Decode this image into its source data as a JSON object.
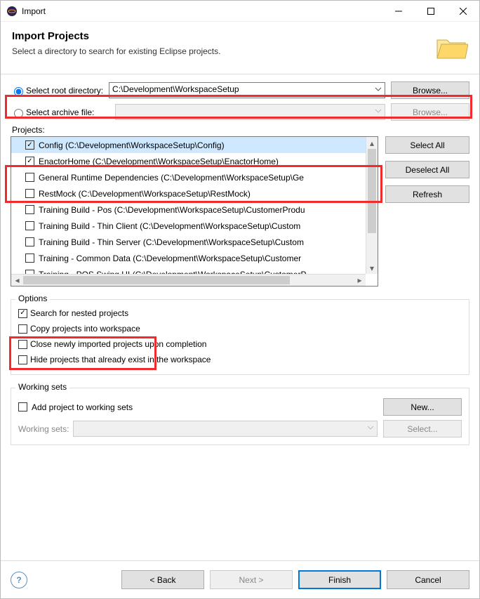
{
  "window": {
    "title": "Import"
  },
  "header": {
    "title": "Import Projects",
    "subtitle": "Select a directory to search for existing Eclipse projects."
  },
  "source": {
    "root_radio_label": "Select root directory:",
    "root_path": "C:\\Development\\WorkspaceSetup",
    "browse_root": "Browse...",
    "archive_radio_label": "Select archive file:",
    "archive_path": "",
    "browse_archive": "Browse..."
  },
  "projects_label": "Projects:",
  "projects": [
    {
      "checked": true,
      "selected": true,
      "label": "Config (C:\\Development\\WorkspaceSetup\\Config)"
    },
    {
      "checked": true,
      "selected": false,
      "label": "EnactorHome (C:\\Development\\WorkspaceSetup\\EnactorHome)"
    },
    {
      "checked": false,
      "selected": false,
      "label": "General Runtime Dependencies (C:\\Development\\WorkspaceSetup\\Ge"
    },
    {
      "checked": false,
      "selected": false,
      "label": "RestMock (C:\\Development\\WorkspaceSetup\\RestMock)"
    },
    {
      "checked": false,
      "selected": false,
      "label": "Training Build - Pos (C:\\Development\\WorkspaceSetup\\CustomerProdu"
    },
    {
      "checked": false,
      "selected": false,
      "label": "Training Build - Thin Client (C:\\Development\\WorkspaceSetup\\Custom"
    },
    {
      "checked": false,
      "selected": false,
      "label": "Training Build - Thin Server (C:\\Development\\WorkspaceSetup\\Custom"
    },
    {
      "checked": false,
      "selected": false,
      "label": "Training - Common Data (C:\\Development\\WorkspaceSetup\\Customer"
    },
    {
      "checked": false,
      "selected": false,
      "label": "Training - POS Swing UI (C:\\Development\\WorkspaceSetup\\CustomerP"
    }
  ],
  "side_buttons": {
    "select_all": "Select All",
    "deselect_all": "Deselect All",
    "refresh": "Refresh"
  },
  "options": {
    "legend": "Options",
    "search_nested": {
      "checked": true,
      "label": "Search for nested projects"
    },
    "copy_into_ws": {
      "checked": false,
      "label": "Copy projects into workspace"
    },
    "close_newly": {
      "checked": false,
      "label": "Close newly imported projects upon completion"
    },
    "hide_existing": {
      "checked": false,
      "label": "Hide projects that already exist in the workspace"
    }
  },
  "working_sets": {
    "legend": "Working sets",
    "add": {
      "checked": false,
      "label": "Add project to working sets"
    },
    "new_btn": "New...",
    "label": "Working sets:",
    "select_btn": "Select..."
  },
  "footer": {
    "back": "< Back",
    "next": "Next >",
    "finish": "Finish",
    "cancel": "Cancel"
  }
}
